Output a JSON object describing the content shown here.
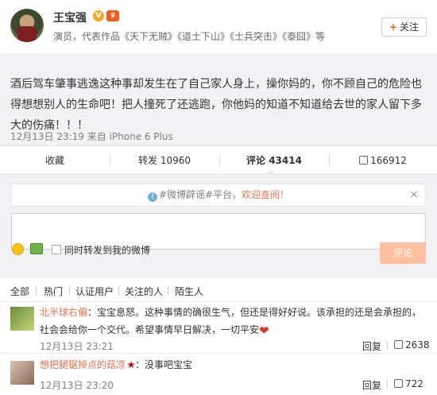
{
  "profile": {
    "name": "王宝强",
    "verified_badge": "V",
    "vip_badge": "♛",
    "description": "演员，代表作品《天下无贼》《道士下山》《士兵突击》《泰囧》等",
    "follow_label": "关注",
    "follow_icon": "+"
  },
  "post": {
    "text": "酒后驾车肇事逃逸这种事却发生在了自己家人身上，操你妈的，你不顾自己的危险也得想想别人的生命吧！把人撞死了还逃跑，你他妈的知道不知道给去世的家人留下多大的伤痛！！！",
    "meta": "12月13日 23:19 来自 iPhone 6 Plus"
  },
  "actions": {
    "favorite": "收藏",
    "repost": "转发 10960",
    "comment": "评论 43414",
    "like": "166912"
  },
  "comment_box": {
    "notice_tag": "#微博辟谣#平台，",
    "notice_link": "欢迎查阅！",
    "close": "×",
    "checkbox_label": "同时转发到我的微博",
    "submit_label": "评论"
  },
  "tabs": [
    "全部",
    "热门",
    "认证用户",
    "关注的人",
    "陌生人"
  ],
  "comments": [
    {
      "user": "北半球右偏",
      "text": "：宝宝息怒。这种事情的确很生气，但还是得好好说。该承担的还是会承担的，社会会给你一个交代。希望事情早日解决，一切平安",
      "time": "12月13日 23:21",
      "reply": "回复",
      "likes": "2638"
    },
    {
      "user": "想把腿锯掉点的菇凉",
      "text": "：没事吧宝宝",
      "time": "12月13日 23:20",
      "reply": "回复",
      "likes": "722"
    }
  ],
  "colors": {
    "accent": "#eb7350",
    "background": "#f2f2f5",
    "submit_disabled": "#ffc09f"
  }
}
